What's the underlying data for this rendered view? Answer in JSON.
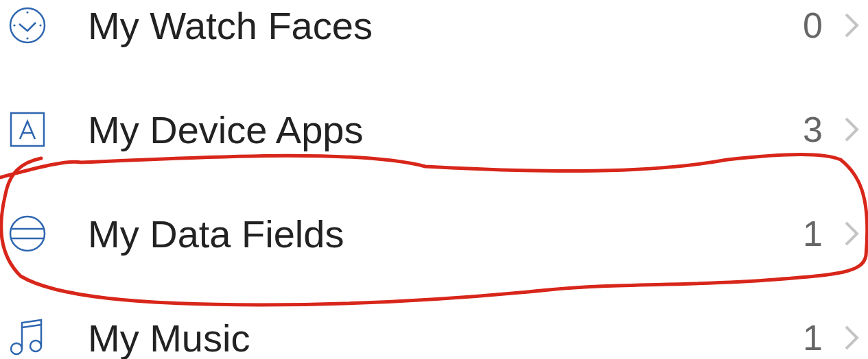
{
  "menu_items": [
    {
      "label": "My Watch Faces",
      "count": "0",
      "circled": false
    },
    {
      "label": "My Device Apps",
      "count": "3",
      "circled": false
    },
    {
      "label": "My Data Fields",
      "count": "1",
      "circled": true
    },
    {
      "label": "My Music",
      "count": "1",
      "circled": false
    }
  ]
}
